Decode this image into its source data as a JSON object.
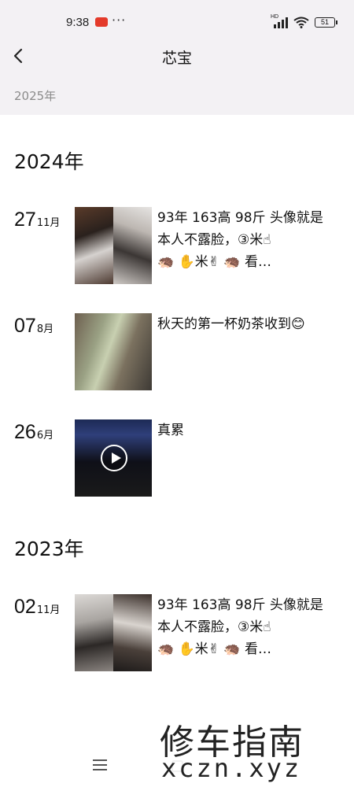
{
  "status_bar": {
    "time": "9:38",
    "more": "···",
    "network_label": "HD",
    "battery_level": "51"
  },
  "header": {
    "title": "芯宝"
  },
  "filter": {
    "year_label": "2025年"
  },
  "timeline": [
    {
      "year": "2024年",
      "posts": [
        {
          "day": "27",
          "month": "11月",
          "text": "93年  163高  98斤  头像就是本人不露脸，③米☝\n🦔     ✋米✌  🦔    看…",
          "media": "photo"
        },
        {
          "day": "07",
          "month": "8月",
          "text": "秋天的第一杯奶茶收到😊",
          "media": "photo"
        },
        {
          "day": "26",
          "month": "6月",
          "text": "真累",
          "media": "video"
        }
      ]
    },
    {
      "year": "2023年",
      "posts": [
        {
          "day": "02",
          "month": "11月",
          "text": "93年  163高  98斤  头像就是本人不露脸，③米☝\n🦔     ✋米✌  🦔    看…",
          "media": "photo"
        }
      ]
    }
  ],
  "watermark": {
    "title": "修车指南",
    "url": "xczn.xyz"
  }
}
